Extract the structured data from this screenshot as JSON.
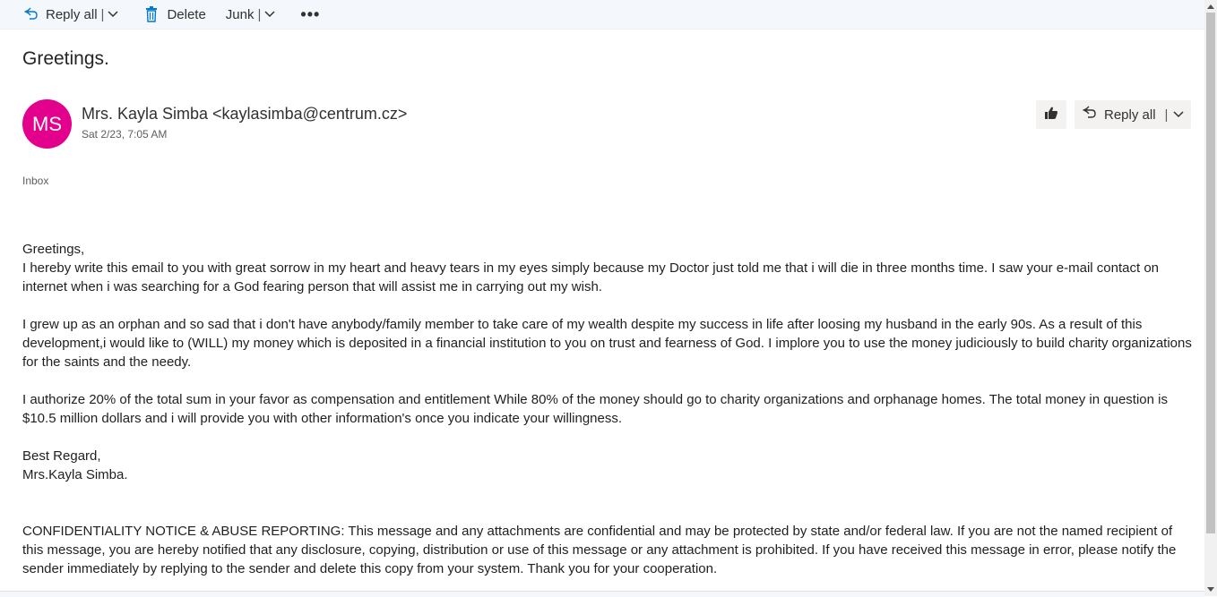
{
  "toolbar": {
    "reply_all": "Reply all",
    "delete": "Delete",
    "junk": "Junk",
    "more": "•••",
    "separator": "|"
  },
  "email": {
    "subject": "Greetings.",
    "avatar_initials": "MS",
    "avatar_color": "#e3008c",
    "sender": "Mrs. Kayla Simba <kaylasimba@centrum.cz>",
    "date": "Sat 2/23, 7:05 AM",
    "folder": "Inbox",
    "reply_all_label": "Reply all",
    "body": {
      "greeting": "Greetings,",
      "p1": "I hereby write this email to you with great sorrow in my heart and heavy tears in my eyes simply because my Doctor just told me that i will die in three months time. I saw your e-mail contact on internet when i was searching for a God fearing person that will assist me in carrying out my wish.",
      "p2": "I grew up as an orphan and so sad that i don't have anybody/family member to take care of my wealth despite my success in life after loosing my husband in the early 90s. As a result of this development,i would like to (WILL) my money which is deposited in a financial institution to you on trust and fearness of God. I implore you to use the money judiciously to build charity organizations for the saints and the needy.",
      "p3": "I authorize 20% of the total sum in your favor as compensation and entitlement While 80% of the money should go to charity organizations and orphanage homes. The total money in question is $10.5 million dollars and i will  provide you with other information's once you indicate your willingness.",
      "closing": "Best Regard,",
      "signature": "Mrs.Kayla Simba.",
      "notice": "CONFIDENTIALITY NOTICE & ABUSE REPORTING: This message and any attachments are confidential and may be protected by state and/or federal law. If you are not the named recipient of this message, you are hereby notified that any disclosure, copying, distribution or use of this message or any attachment is prohibited. If you have received this message in error, please notify the sender immediately by replying to the sender and delete this copy from your system. Thank you for your cooperation."
    }
  },
  "icons": {
    "reply_all": "reply-all-icon",
    "delete": "trash-icon",
    "chevron": "chevron-down-icon",
    "like": "thumbs-up-icon"
  },
  "colors": {
    "accent": "#0078d4",
    "toolbar_bg": "#f4f7fb"
  }
}
